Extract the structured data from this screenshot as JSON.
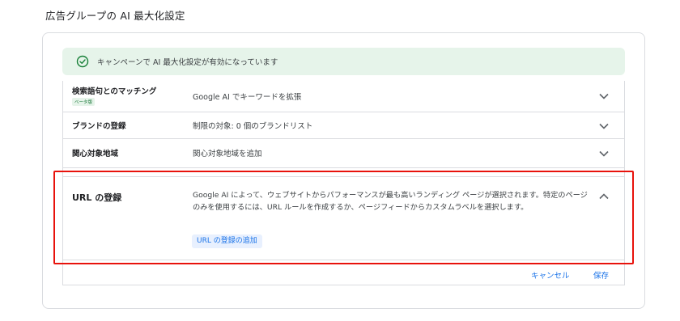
{
  "page": {
    "title": "広告グループの AI 最大化設定"
  },
  "banner": {
    "text": "キャンペーンで AI 最大化設定が有効になっています",
    "icon": "check-circle-icon",
    "bg_color": "#e6f4ea",
    "icon_color": "#188038"
  },
  "rows": [
    {
      "label": "検索語句とのマッチング",
      "badge": "ベータ版",
      "description": "Google AI でキーワードを拡張",
      "icon": "chevron-down-icon"
    },
    {
      "label": "ブランドの登録",
      "description": "制限の対象: 0 個のブランドリスト",
      "icon": "chevron-down-icon"
    },
    {
      "label": "関心対象地域",
      "description": "関心対象地域を追加",
      "icon": "chevron-down-icon"
    }
  ],
  "url_section": {
    "label": "URL の登録",
    "description": "Google AI によって、ウェブサイトからパフォーマンスが最も高いランディング ページが選択されます。特定のページのみを使用するには、URL ルールを作成するか、ページフィードからカスタムラベルを選択します。",
    "add_button": "URL の登録の追加",
    "icon": "chevron-up-icon"
  },
  "footer": {
    "cancel": "キャンセル",
    "save": "保存"
  },
  "colors": {
    "accent": "#1a73e8",
    "highlight": "#e8120c",
    "border": "#dadce0"
  }
}
